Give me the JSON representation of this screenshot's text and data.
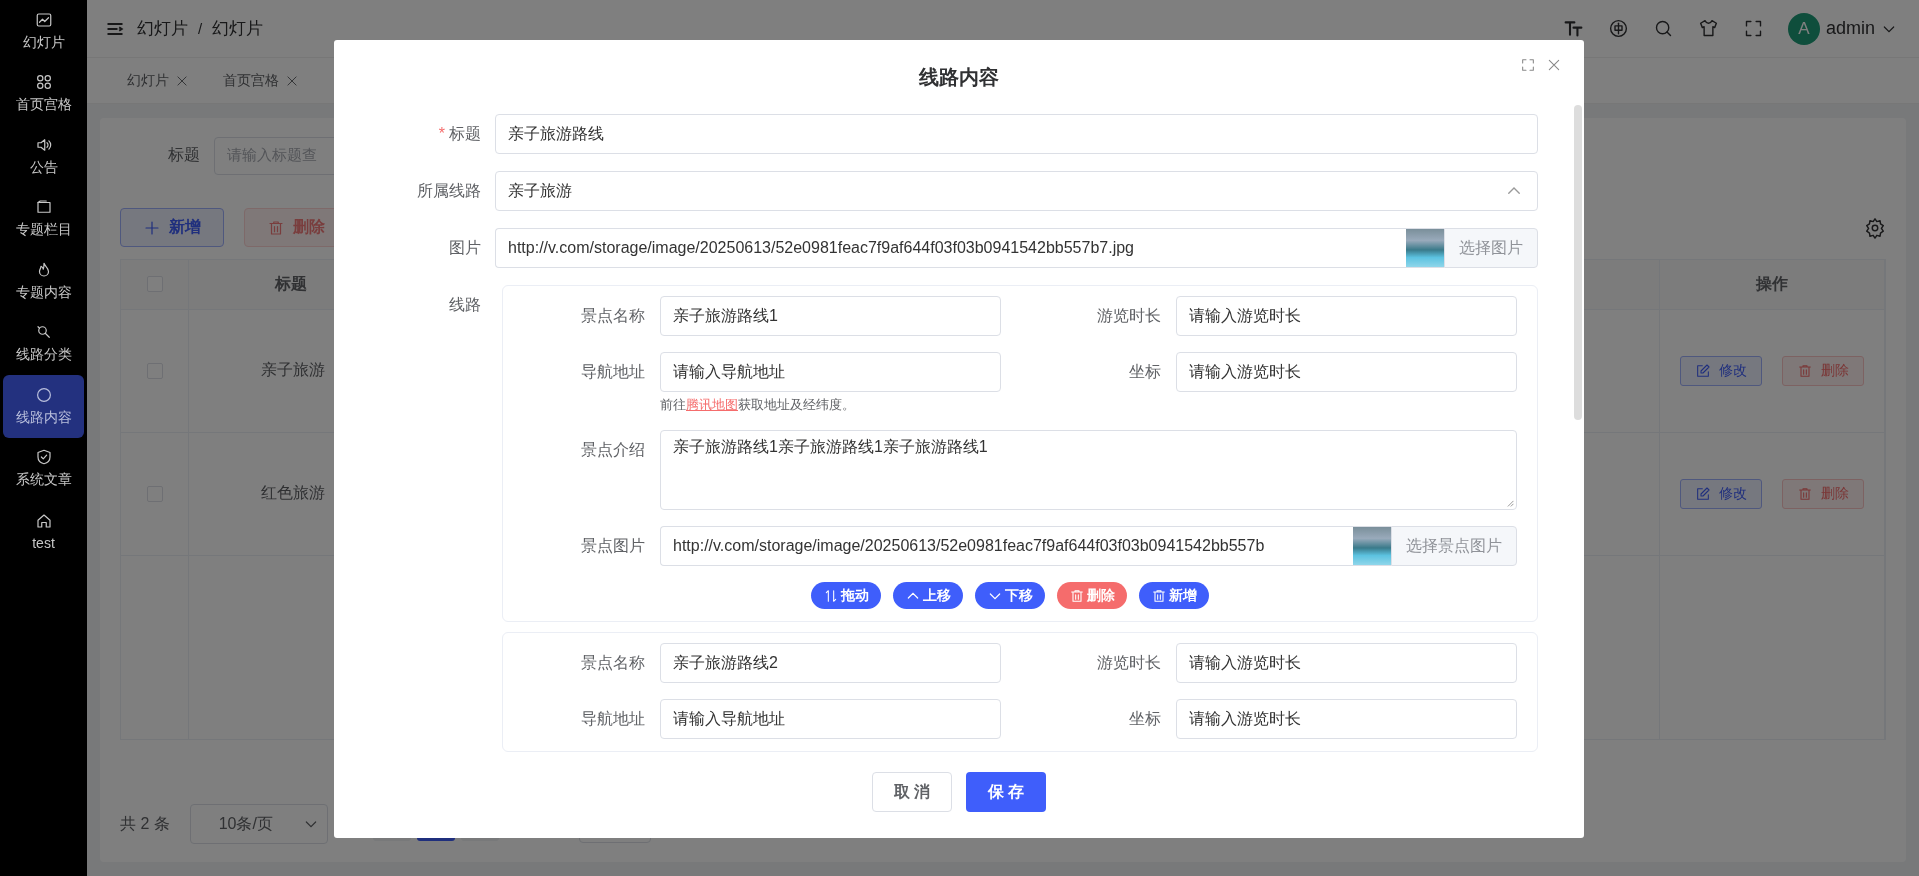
{
  "sidebar": {
    "items": [
      {
        "label": "幻灯片",
        "selected": false
      },
      {
        "label": "首页宫格",
        "selected": false
      },
      {
        "label": "公告",
        "selected": false
      },
      {
        "label": "专题栏目",
        "selected": false
      },
      {
        "label": "专题内容",
        "selected": false
      },
      {
        "label": "线路分类",
        "selected": false
      },
      {
        "label": "线路内容",
        "selected": true
      },
      {
        "label": "系统文章",
        "selected": false
      },
      {
        "label": "test",
        "selected": false
      }
    ]
  },
  "header": {
    "breadcrumb": [
      "幻灯片",
      "幻灯片"
    ],
    "separator": "/",
    "user": {
      "avatar_letter": "A",
      "name": "admin"
    }
  },
  "tabs": [
    {
      "label": "幻灯片",
      "selected": false
    },
    {
      "label": "首页宫格",
      "selected": false
    }
  ],
  "search": {
    "label": "标题",
    "placeholder": "请输入标题查"
  },
  "toolbar": {
    "buttons": [
      {
        "label": "新增",
        "kind": "add",
        "disabled": false
      },
      {
        "label": "删除",
        "kind": "delete",
        "disabled": true
      }
    ]
  },
  "table": {
    "all_checked": false,
    "columns": [
      {
        "label": "标题"
      },
      {
        "label": "操作"
      }
    ],
    "rows": [
      {
        "title": "亲子旅游",
        "checked": false,
        "actions": [
          {
            "label": "修改",
            "kind": "edit"
          },
          {
            "label": "删除",
            "kind": "delete"
          }
        ]
      },
      {
        "title": "红色旅游",
        "checked": false,
        "actions": [
          {
            "label": "修改",
            "kind": "edit"
          },
          {
            "label": "删除",
            "kind": "delete"
          }
        ]
      }
    ]
  },
  "pagination": {
    "total": "共 2 条",
    "page_size": "10条/页",
    "pages": [
      {
        "selected": false
      },
      {
        "selected": true
      },
      {
        "selected": false
      }
    ]
  },
  "modal": {
    "title": "线路内容",
    "fields": [
      {
        "kind": "text",
        "label": "标题",
        "required_mark": "*",
        "value": "亲子旅游路线"
      },
      {
        "kind": "select",
        "label": "所属线路",
        "value": "亲子旅游",
        "expanded": true
      },
      {
        "kind": "image",
        "label": "图片",
        "value": "http://v.com/storage/image/20250613/52e0981feac7f9af644f03f03b0941542bb557b7.jpg",
        "button": "选择图片"
      }
    ],
    "route": {
      "label": "线路",
      "stops": [
        {
          "name_label": "景点名称",
          "name": "亲子旅游路线1",
          "duration_label": "游览时长",
          "duration_placeholder": "请输入游览时长",
          "nav_label": "导航地址",
          "nav_placeholder": "请输入导航地址",
          "coord_label": "坐标",
          "coord_placeholder": "请输入游览时长",
          "hint": {
            "before": "前往",
            "link": "腾讯地图",
            "after": "获取地址及经纬度。"
          },
          "intro_label": "景点介绍",
          "intro": "亲子旅游路线1亲子旅游路线1亲子旅游路线1",
          "image_label": "景点图片",
          "image": "http://v.com/storage/image/20250613/52e0981feac7f9af644f03f03b0941542bb557b",
          "image_button": "选择景点图片",
          "actions": [
            {
              "label": "拖动",
              "kind": "drag"
            },
            {
              "label": "上移",
              "kind": "up"
            },
            {
              "label": "下移",
              "kind": "down"
            },
            {
              "label": "删除",
              "kind": "delete"
            },
            {
              "label": "新增",
              "kind": "add"
            }
          ]
        },
        {
          "name_label": "景点名称",
          "name": "亲子旅游路线2",
          "duration_label": "游览时长",
          "duration_placeholder": "请输入游览时长",
          "nav_label": "导航地址",
          "nav_placeholder": "请输入导航地址",
          "coord_label": "坐标",
          "coord_placeholder": "请输入游览时长"
        }
      ]
    },
    "footer": {
      "cancel": "取 消",
      "save": "保 存"
    }
  }
}
